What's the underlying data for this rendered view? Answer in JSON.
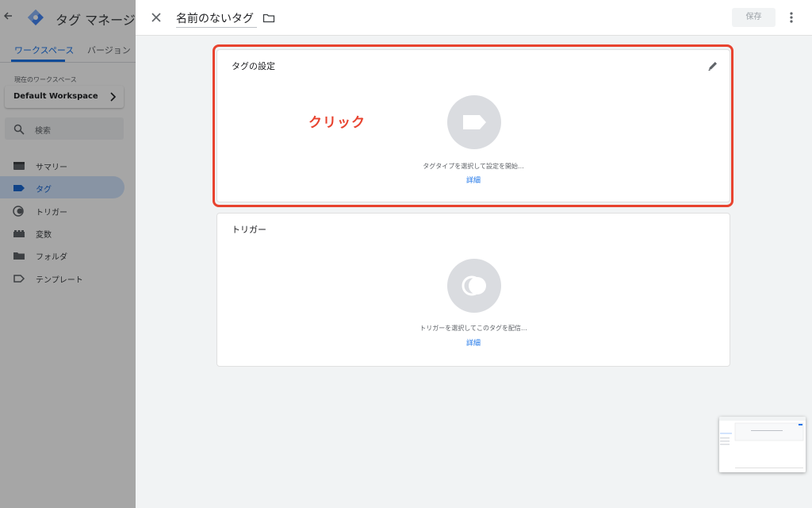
{
  "app": {
    "title": "タグ マネージャー",
    "tabs": [
      {
        "label": "ワークスペース",
        "active": true
      },
      {
        "label": "バージョン",
        "active": false
      }
    ],
    "workspace_label": "現在のワークスペース",
    "workspace_name": "Default Workspace",
    "search_placeholder": "検索",
    "nav": [
      {
        "label": "サマリー",
        "icon": "summary-icon",
        "active": false
      },
      {
        "label": "タグ",
        "icon": "tag-icon",
        "active": true
      },
      {
        "label": "トリガー",
        "icon": "trigger-icon",
        "active": false
      },
      {
        "label": "変数",
        "icon": "variables-icon",
        "active": false
      },
      {
        "label": "フォルダ",
        "icon": "folder-icon",
        "active": false
      },
      {
        "label": "テンプレート",
        "icon": "template-icon",
        "active": false
      }
    ]
  },
  "panel": {
    "tag_name": "名前のないタグ",
    "save_label": "保存",
    "tag_config": {
      "title": "タグの設定",
      "description": "タグタイプを選択して設定を開始...",
      "link": "詳細"
    },
    "trigger": {
      "title": "トリガー",
      "description": "トリガーを選択してこのタグを配信...",
      "link": "詳細"
    }
  },
  "annotation": {
    "text": "クリック",
    "color": "#e8432f"
  },
  "colors": {
    "accent": "#1a73e8",
    "highlight": "#e8432f",
    "active_nav_bg": "#d2e3fc"
  }
}
